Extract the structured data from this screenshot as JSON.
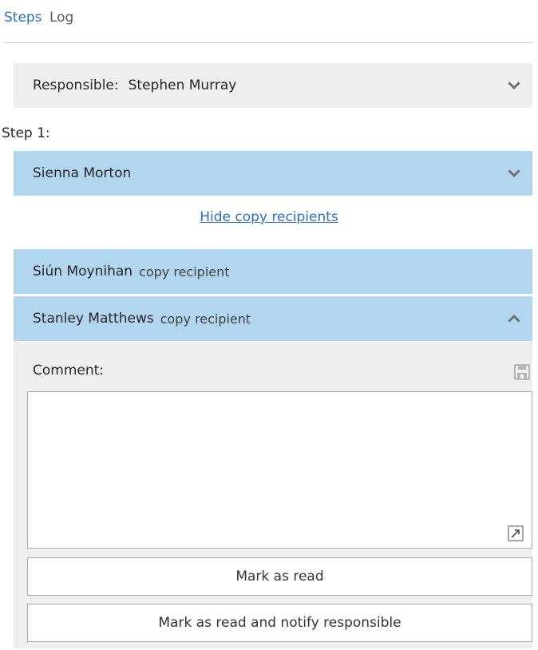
{
  "tabs": {
    "steps": "Steps",
    "log": "Log"
  },
  "responsible": {
    "label": "Responsible:",
    "name": "Stephen Murray",
    "chevron": "chevron-down-icon"
  },
  "step": {
    "label": "Step 1:",
    "recipient": {
      "name": "Sienna Morton",
      "chevron": "chevron-down-icon"
    },
    "hide_copy_link": "Hide copy recipients",
    "copy_recipients": [
      {
        "name": "Siún Moynihan",
        "role": "copy recipient"
      },
      {
        "name": "Stanley Matthews",
        "role": "copy recipient",
        "expanded": true,
        "chevron": "chevron-up-icon"
      }
    ]
  },
  "detail": {
    "comment_label": "Comment:",
    "comment_value": "",
    "mark_read_button": "Mark as read",
    "mark_read_notify_button": "Mark as read and notify responsible"
  },
  "colors": {
    "accent_link": "#2f6fc1",
    "row_selected": "#b3d6f0",
    "row_grey": "#efefef"
  }
}
